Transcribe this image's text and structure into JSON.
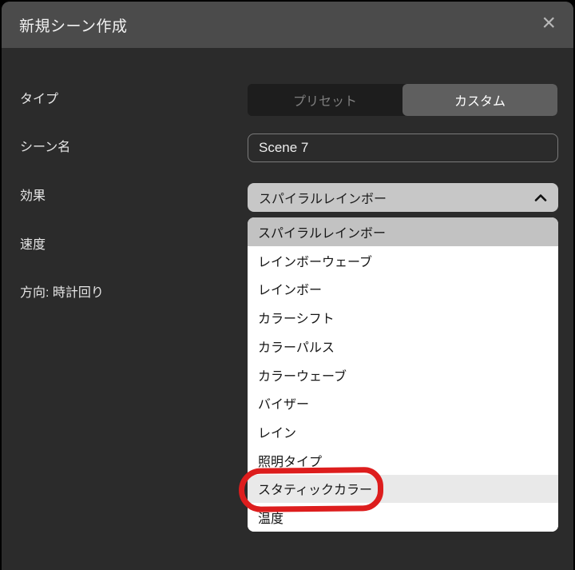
{
  "window": {
    "title": "新規シーン作成",
    "close_icon": "×"
  },
  "form": {
    "type": {
      "label": "タイプ",
      "options": [
        {
          "label": "プリセット",
          "selected": false
        },
        {
          "label": "カスタム",
          "selected": true
        }
      ]
    },
    "scene_name": {
      "label": "シーン名",
      "value": "Scene 7"
    },
    "effect": {
      "label": "効果",
      "value": "スパイラルレインボー",
      "expanded": true
    },
    "speed": {
      "label": "速度"
    },
    "direction": {
      "label": "方向: 時計回り"
    }
  },
  "effect_dropdown": {
    "items": [
      {
        "label": "スパイラルレインボー",
        "state": "selected"
      },
      {
        "label": "レインボーウェーブ",
        "state": "normal"
      },
      {
        "label": "レインボー",
        "state": "normal"
      },
      {
        "label": "カラーシフト",
        "state": "normal"
      },
      {
        "label": "カラーパルス",
        "state": "normal"
      },
      {
        "label": "カラーウェーブ",
        "state": "normal"
      },
      {
        "label": "バイザー",
        "state": "normal"
      },
      {
        "label": "レイン",
        "state": "normal"
      },
      {
        "label": "照明タイプ",
        "state": "normal"
      },
      {
        "label": "スタティックカラー",
        "state": "highlighted"
      },
      {
        "label": "温度",
        "state": "normal"
      }
    ]
  },
  "annotation": {
    "shape": "hand-drawn-red-circle",
    "around_item": "スタティックカラー",
    "color": "#dd1d1d"
  },
  "colors": {
    "titlebar_bg": "#4b4b4b",
    "body_bg": "#2b2b2b",
    "segment_active_bg": "#5f5f5f",
    "segment_inactive_bg": "#1d1d1d",
    "dropdown_button_bg": "#c7c7c7",
    "list_selected_bg": "#c2c2c2",
    "list_highlight_bg": "#e9e9e9"
  }
}
